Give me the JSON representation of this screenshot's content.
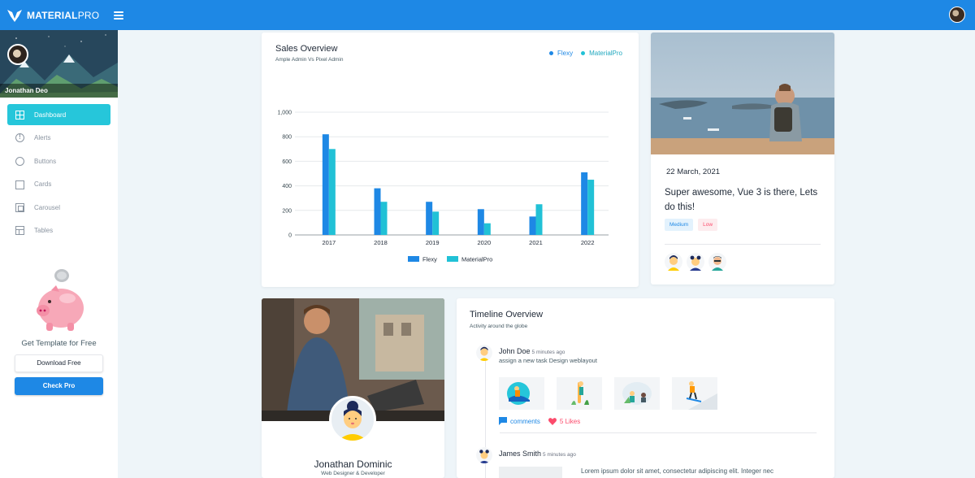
{
  "app": {
    "brand_bold": "MATERIAL",
    "brand_light": "PRO"
  },
  "sidebar": {
    "user_name": "Jonathan Deo",
    "items": [
      {
        "label": "Dashboard",
        "icon": "dashboard-icon",
        "active": true
      },
      {
        "label": "Alerts",
        "icon": "alert-circle-icon"
      },
      {
        "label": "Buttons",
        "icon": "circle-icon"
      },
      {
        "label": "Cards",
        "icon": "card-icon"
      },
      {
        "label": "Carousel",
        "icon": "carousel-icon"
      },
      {
        "label": "Tables",
        "icon": "table-icon"
      }
    ],
    "promo": {
      "title": "Get Template for Free",
      "download_label": "Download Free",
      "pro_label": "Check Pro"
    }
  },
  "sales": {
    "title": "Sales Overview",
    "subtitle": "Ample Admin Vs Pixel Admin",
    "colors": {
      "flexy": "#1e88e5",
      "materialpro": "#21c1d6"
    }
  },
  "chart_data": {
    "type": "bar",
    "categories": [
      "2017",
      "2018",
      "2019",
      "2020",
      "2021",
      "2022"
    ],
    "series": [
      {
        "name": "Flexy",
        "values": [
          820,
          380,
          270,
          210,
          150,
          510
        ]
      },
      {
        "name": "MaterialPro",
        "values": [
          700,
          270,
          190,
          95,
          250,
          450
        ]
      }
    ],
    "ylim": [
      0,
      1000
    ],
    "yticks": [
      "0",
      "200",
      "400",
      "600",
      "800",
      "1,000"
    ],
    "grid": true,
    "legend": "top-right and bottom"
  },
  "blog": {
    "date": "22 March, 2021",
    "title": "Super awesome, Vue 3 is there, Lets do this!",
    "tags": [
      "Medium",
      "Low"
    ]
  },
  "profile": {
    "name": "Jonathan Dominic",
    "role": "Web Designer & Developer"
  },
  "timeline": {
    "title": "Timeline Overview",
    "subtitle": "Activity around the globe",
    "items": [
      {
        "name": "John Doe",
        "time": "5 minutes ago",
        "text": "assign a new task Design weblayout",
        "comments_label": "comments",
        "likes_label": "5 Likes"
      },
      {
        "name": "James Smith",
        "time": "5 minutes ago",
        "text": "Lorem ipsum dolor sit amet, consectetur adipiscing elit. Integer nec"
      }
    ]
  }
}
